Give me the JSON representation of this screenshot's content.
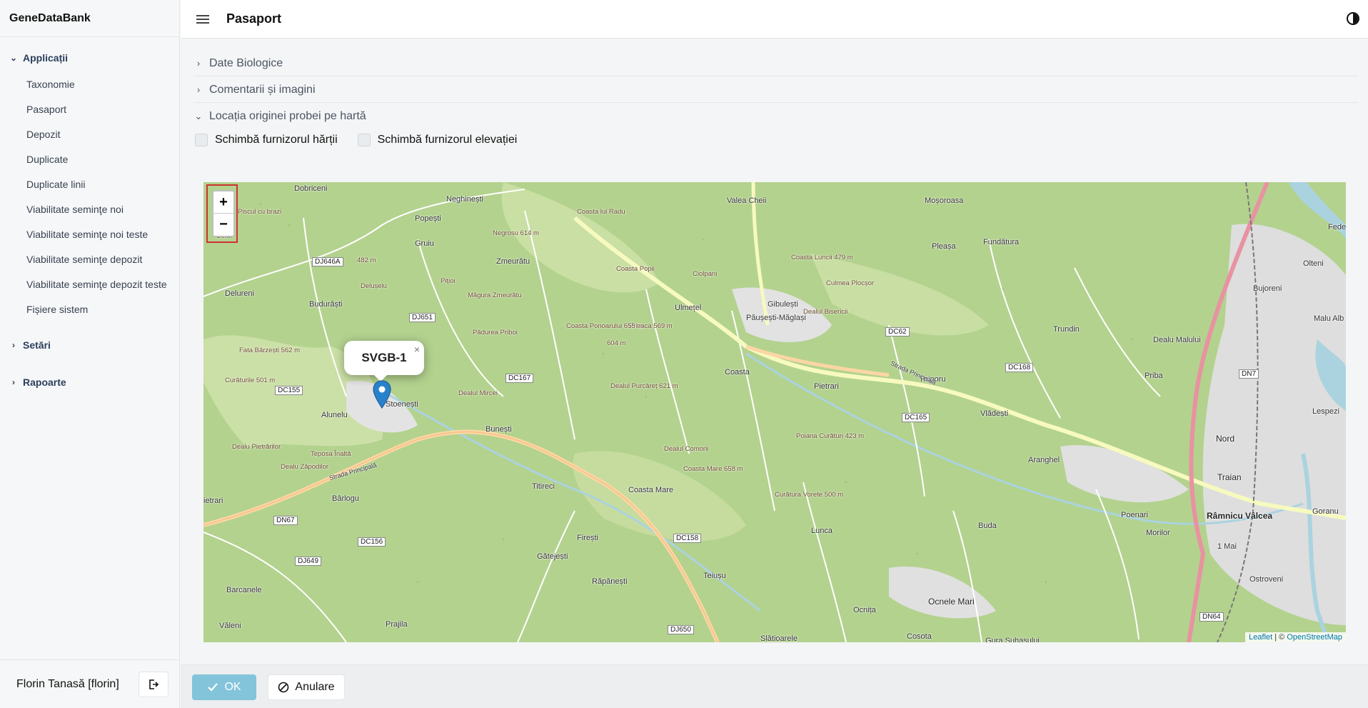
{
  "app": {
    "title": "GeneDataBank"
  },
  "sidebar": {
    "groups": [
      {
        "label": "Applicații",
        "expanded": true
      },
      {
        "label": "Setări",
        "expanded": false
      },
      {
        "label": "Rapoarte",
        "expanded": false
      }
    ],
    "items": [
      {
        "label": "Taxonomie"
      },
      {
        "label": "Pasaport"
      },
      {
        "label": "Depozit"
      },
      {
        "label": "Duplicate"
      },
      {
        "label": "Duplicate linii"
      },
      {
        "label": "Viabilitate seminţe noi"
      },
      {
        "label": "Viabilitate seminţe noi teste"
      },
      {
        "label": "Viabilitate seminţe depozit"
      },
      {
        "label": "Viabilitate seminţe depozit teste"
      },
      {
        "label": "Fișiere sistem"
      }
    ],
    "user": "Florin Tanasă [florin]"
  },
  "header": {
    "title": "Pasaport"
  },
  "sections": [
    {
      "label": "Date Biologice",
      "expanded": false
    },
    {
      "label": "Comentarii și imagini",
      "expanded": false
    },
    {
      "label": "Locația originei probei pe hartă",
      "expanded": true
    }
  ],
  "checkboxes": [
    {
      "label": "Schimbă furnizorul hărții",
      "checked": false
    },
    {
      "label": "Schimbă furnizorul elevației",
      "checked": false
    }
  ],
  "map": {
    "zoom_in": "+",
    "zoom_out": "−",
    "popup_text": "SVGB-1",
    "popup_close": "×",
    "attribution_leaflet": "Leaflet",
    "attribution_sep": " | © ",
    "attribution_osm": "OpenStreetMap",
    "labels": {
      "dobriceni": "Dobriceni",
      "neghinesti": "Neghinești",
      "popesti": "Popești",
      "gruiu": "Gruiu",
      "zmeuratu": "Zmeurătu",
      "valea_cheii": "Valea Cheii",
      "mosoroasa": "Moșoroasa",
      "fundatura": "Fundătura",
      "pleasa": "Pleașa",
      "olteni": "Olteni",
      "bujoreni": "Bujoreni",
      "malu_alb": "Malu Alb",
      "budurasti": "Budurăști",
      "ulmetel": "Ulmețel",
      "pausesti": "Păușești-Măglași",
      "gibulesti": "Gibulești",
      "coasta": "Coasta",
      "pietrari": "Pietrari",
      "priporu": "Priporu",
      "trundin": "Trundin",
      "dealu_malului": "Dealu Malului",
      "priba": "Priba",
      "vladesti": "Vlădești",
      "stoenesti": "Stoenești",
      "alunelu": "Alunelu",
      "bunesti": "Bunești",
      "aranghel": "Aranghel",
      "nord": "Nord",
      "traian": "Traian",
      "titireci": "Titireci",
      "coasta_mare": "Coasta Mare",
      "barlogu": "Bârlogu",
      "poenari": "Poenari",
      "ramnicu": "Râmnicu Vâlcea",
      "goranu": "Goranu",
      "morilor": "Morilor",
      "buda": "Buda",
      "firesti": "Firești",
      "lunca": "Lunca",
      "gatejesti": "Gătejești",
      "mai1": "1 Mai",
      "barcanele": "Barcanele",
      "rapanesti": "Răpănești",
      "teiusu": "Teiușu",
      "ostroveni": "Ostroveni",
      "valeni": "Văleni",
      "prajila": "Prajila",
      "ocnita": "Ocnița",
      "ocnele": "Ocnele Mari",
      "slatioarele": "Slătioarele",
      "cosota": "Cosota",
      "gura": "Gura Suhașului",
      "lespezi": "Lespezi",
      "fede": "Fede",
      "delureni": "Delureni",
      "pietrari_w": "ietrari",
      "dealu_pietrarilor": "Dealu Pietrărilor",
      "dealu_zapodilor": "Dealu Zăpodilor",
      "teposa": "Teposa Înaltă",
      "fata": "Fata Bârzești 562 m",
      "curaturile": "Curăturile 501 m",
      "deluselu": "Delușelu",
      "m482": "482 m",
      "pitioi": "Pițioi",
      "magura": "Măgura Zmeurătu",
      "negrosu": "Negrosu 614 m",
      "coasta_lui_radu": "Coasta lui Radu",
      "coasta_popii": "Coasta Popii",
      "ciolpani": "Ciolpani",
      "coasta_luncii": "Coasta Luncii 479 m",
      "culmea": "Culmea Plocșor",
      "dealu_bisericii": "Dealul Bisericii",
      "prisaca": "Prisaca 569 m",
      "m604": "604 m",
      "coasta_ponoarului": "Coasta Ponoarului 655 m",
      "dealul_purcaret": "Dealul Purcăreț 621 m",
      "dealul_mircei": "Dealul Mircei",
      "padurea_pribol": "Pădurea Priboi",
      "dealul_comorii": "Dealul Comorii",
      "coasta_mare_658": "Coasta Mare 658 m",
      "poiana": "Poiana Curături 423 m",
      "curatura": "Curătura Vorete 500 m",
      "piscul": "Piscul cu brazi",
      "sorbi": "Sorbi"
    },
    "roads": {
      "dj646a": "DJ646A",
      "dj651": "DJ651",
      "dc155": "DC155",
      "dc167": "DC167",
      "dc62": "DC62",
      "dc168": "DC168",
      "dc165": "DC165",
      "dn7": "DN7",
      "dn67": "DN67",
      "dc156": "DC156",
      "dj649": "DJ649",
      "dc158": "DC158",
      "dj650": "DJ650",
      "dn64": "DN64",
      "strada": "Strada Principală"
    }
  },
  "footer": {
    "ok": "OK",
    "cancel": "Anulare"
  }
}
